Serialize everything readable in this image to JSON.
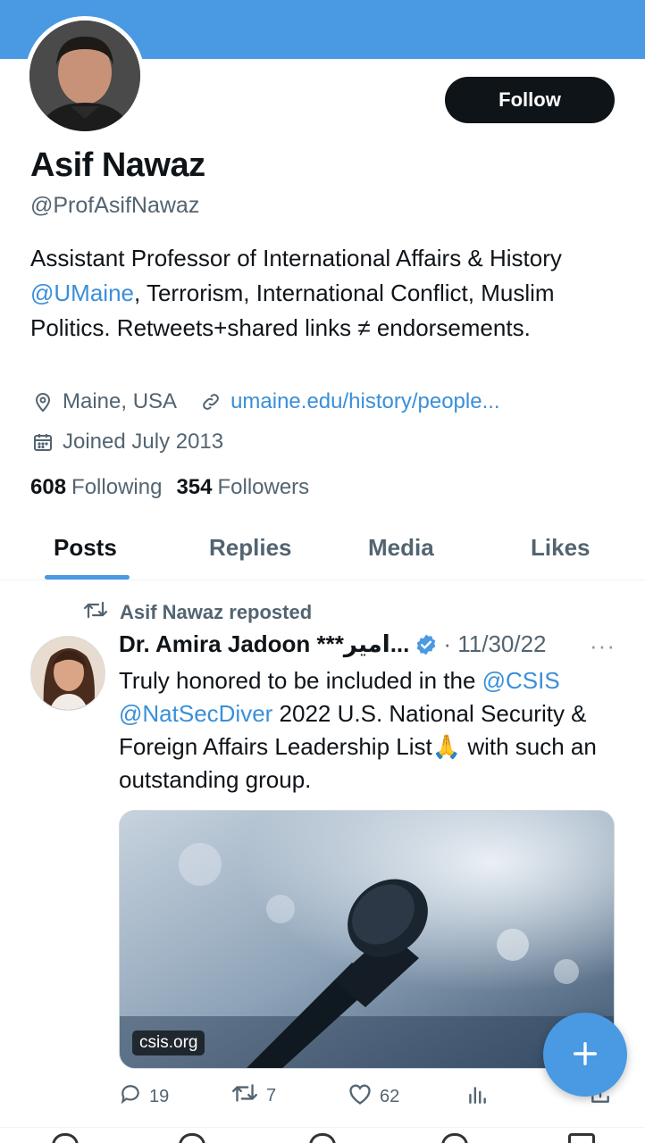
{
  "profile": {
    "name": "Asif Nawaz",
    "handle": "@ProfAsifNawaz",
    "follow_label": "Follow",
    "bio_part1": "Assistant Professor of International Affairs & History ",
    "bio_mention": "@UMaine",
    "bio_part2": ", Terrorism, International Conflict, Muslim Politics. Retweets+shared links ≠ endorsements.",
    "location": "Maine, USA",
    "website": "umaine.edu/history/people...",
    "joined": "Joined July 2013",
    "following_count": "608",
    "following_label": "Following",
    "followers_count": "354",
    "followers_label": "Followers"
  },
  "tabs": [
    "Posts",
    "Replies",
    "Media",
    "Likes"
  ],
  "active_tab": "Posts",
  "tweet": {
    "repost_text": "Asif Nawaz reposted",
    "author": "Dr. Amira Jadoon ***امیر...",
    "date": "· 11/30/22",
    "more": "···",
    "text_part1": "Truly honored to be included in the ",
    "mention1": "@CSIS",
    "mention2": "@NatSecDiver",
    "text_part2": " 2022 U.S. National Security & Foreign Affairs Leadership List",
    "emoji": "🙏",
    "text_part3": " with such an outstanding group.",
    "media_label": "csis.org",
    "replies": "19",
    "reposts": "7",
    "likes": "62"
  },
  "colors": {
    "accent": "#4a99e3",
    "text": "#0f1419",
    "muted": "#536471",
    "button": "#0f1419"
  }
}
